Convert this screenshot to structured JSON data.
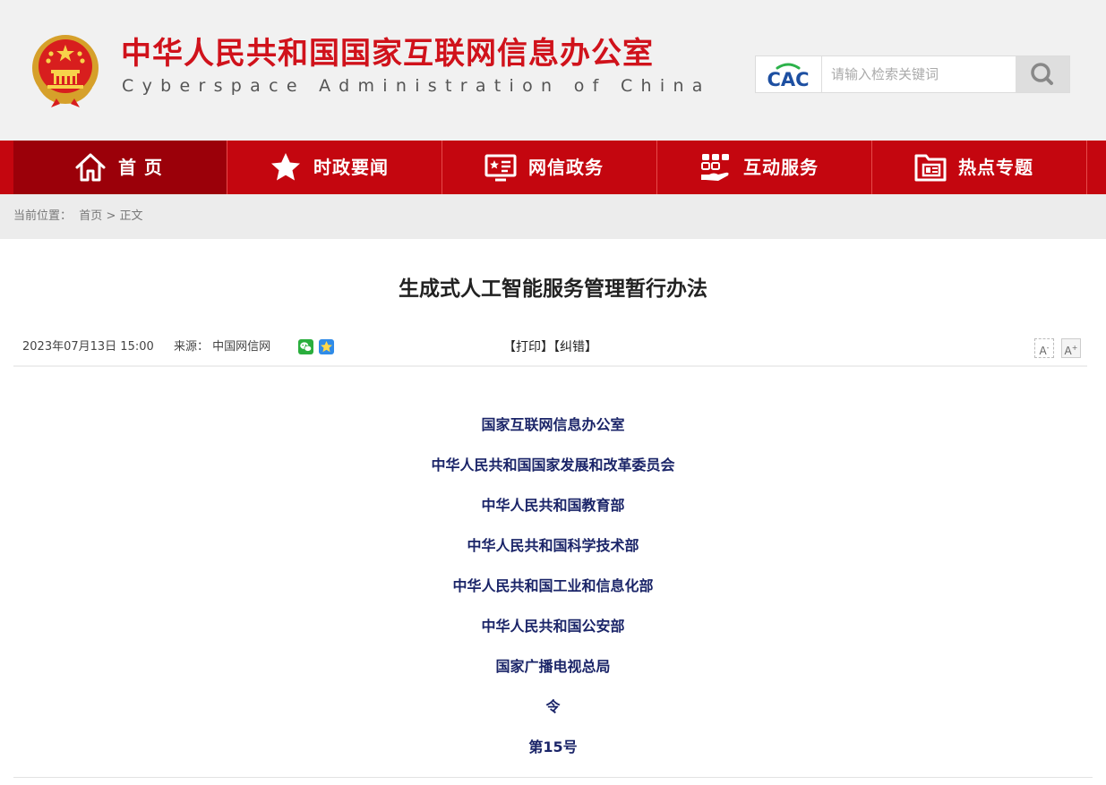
{
  "header": {
    "title": "中华人民共和国国家互联网信息办公室",
    "subtitle": "Cyberspace Administration of China",
    "emblem_icon": "national-emblem-icon",
    "search": {
      "brand_logo": "CAC",
      "placeholder": "请输入检索关键词",
      "button_icon": "search-icon"
    }
  },
  "nav": {
    "items": [
      {
        "label": "首 页",
        "icon": "home-icon",
        "active": true
      },
      {
        "label": "时政要闻",
        "icon": "star-icon"
      },
      {
        "label": "网信政务",
        "icon": "monitor-icon"
      },
      {
        "label": "互动服务",
        "icon": "interaction-icon"
      },
      {
        "label": "热点专题",
        "icon": "folder-icon"
      }
    ]
  },
  "breadcrumb": {
    "prefix": "当前位置：",
    "home": "首页",
    "separator": ">",
    "current": "正文"
  },
  "article": {
    "title": "生成式人工智能服务管理暂行办法",
    "date": "2023年07月13日 15:00",
    "source_label": "来源：",
    "source": "中国网信网",
    "share_icons": [
      "wechat-icon",
      "qzone-icon"
    ],
    "print_label": "【打印】",
    "correct_label": "【纠错】",
    "font_smaller": "A",
    "font_larger": "A",
    "body_lines": [
      "国家互联网信息办公室",
      "中华人民共和国国家发展和改革委员会",
      "中华人民共和国教育部",
      "中华人民共和国科学技术部",
      "中华人民共和国工业和信息化部",
      "中华人民共和国公安部",
      "国家广播电视总局",
      "令",
      "第15号"
    ]
  },
  "colors": {
    "brand_red": "#c4060f",
    "nav_active": "#9b0009",
    "title_red": "#d0121b",
    "body_navy": "#1a2468",
    "header_bg": "#f1f1f1"
  }
}
